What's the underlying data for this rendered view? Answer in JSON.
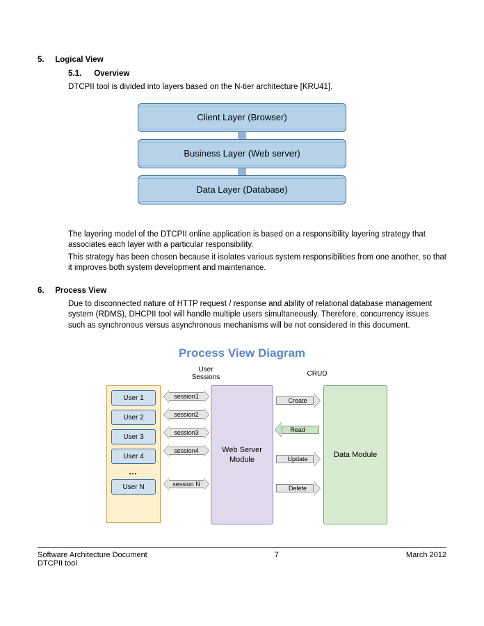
{
  "section5": {
    "num": "5.",
    "title": "Logical View",
    "sub": {
      "num": "5.1.",
      "title": "Overview"
    },
    "intro": "DTCPII tool is divided into layers based on the N-tier architecture [KRU41].",
    "layers": [
      "Client Layer (Browser)",
      "Business Layer (Web server)",
      "Data Layer (Database)"
    ],
    "para1": "The layering model of the DTCPII online application is based on a responsibility layering strategy that associates each layer with a particular responsibility.",
    "para2": "This strategy has been chosen because it isolates various system responsibilities from one another, so that it improves both system development and maintenance."
  },
  "section6": {
    "num": "6.",
    "title": "Process View",
    "para": "Due to disconnected nature of HTTP request / response and ability of relational database management system (RDMS), DHCPII tool will handle multiple users simultaneously. Therefore, concurrency issues such as synchronous versus asynchronous mechanisms will be not considered in this document.",
    "diagramTitle": "Process View Diagram",
    "labelSessions": "User Sessions",
    "labelCrud": "CRUD",
    "users": [
      "User 1",
      "User 2",
      "User 3",
      "User 4",
      "User N"
    ],
    "dots": "…",
    "sessions": [
      "session1",
      "session2",
      "session3",
      "session4",
      "session N"
    ],
    "webserver": "Web Server Module",
    "crud": [
      "Create",
      "Read",
      "Update",
      "Delete"
    ],
    "dataModule": "Data Module"
  },
  "footer": {
    "doc": "Software Architecture Document",
    "tool": "DTCPII tool",
    "page": "7",
    "date": "March 2012"
  }
}
